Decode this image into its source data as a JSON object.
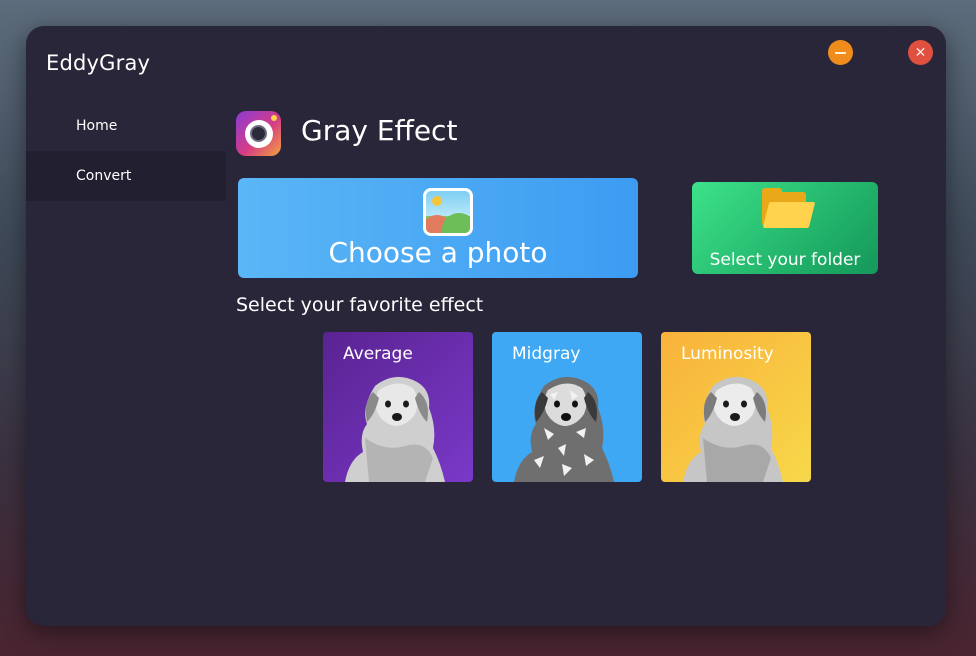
{
  "app": {
    "title": "EddyGray"
  },
  "sidebar": {
    "items": [
      {
        "label": "Home"
      },
      {
        "label": "Convert"
      }
    ]
  },
  "page": {
    "title": "Gray Effect",
    "choose_photo": "Choose a photo",
    "select_folder": "Select your folder",
    "section_label": "Select your favorite effect"
  },
  "effects": [
    {
      "label": "Average"
    },
    {
      "label": "Midgray"
    },
    {
      "label": "Luminosity"
    }
  ],
  "colors": {
    "window_bg": "#29263a",
    "sidebar_active": "#221f31",
    "choose_card": "#4aa9f4",
    "folder_card": "#25c474",
    "average_card": "#6a2db0",
    "midgray_card": "#3ea8f4",
    "luminosity_card": "#f8c542",
    "minimize_button": "#f08c1c",
    "close_button": "#e0503f"
  },
  "icons": {
    "minimize": "minimize-icon",
    "close": "close-icon",
    "logo": "camera-logo-icon",
    "photo": "image-icon",
    "folder": "folder-icon",
    "dog_thumbnail": "dog-image"
  }
}
